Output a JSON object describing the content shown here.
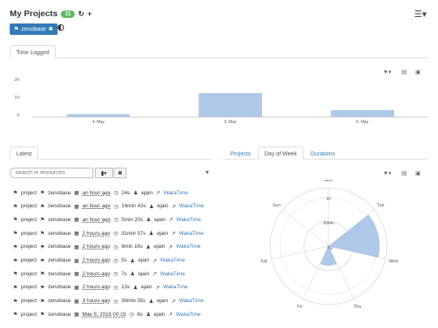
{
  "header": {
    "title": "My Projects",
    "count": "11",
    "refresh_icon": "refresh-icon",
    "add_icon": "plus-icon",
    "menu_icon": "hamburger-menu-icon"
  },
  "filter": {
    "chip_label": "zenobase",
    "chip_color": "#337ab7"
  },
  "time_logged": {
    "tab": "Time Logged",
    "chart_data": {
      "type": "bar",
      "categories": [
        "4. May",
        "5. May",
        "6. May"
      ],
      "values": [
        0.12,
        1.3,
        0.35
      ],
      "yticks": [
        "2h",
        "1h",
        "0"
      ],
      "ylim": [
        0,
        2
      ],
      "color": "#aec8ea"
    }
  },
  "latest": {
    "tab": "Latest",
    "search_placeholder": "search in resources",
    "rows": [
      {
        "tag": "project",
        "project": "zenobase",
        "when": "an hour ago",
        "duration": "24s",
        "user": "ejain",
        "link": "WakaTime"
      },
      {
        "tag": "project",
        "project": "zenobase",
        "when": "an hour ago",
        "duration": "16min 43s",
        "user": "ejain",
        "link": "WakaTime"
      },
      {
        "tag": "project",
        "project": "zenobase",
        "when": "an hour ago",
        "duration": "5min 20s",
        "user": "ejain",
        "link": "WakaTime"
      },
      {
        "tag": "project",
        "project": "zenobase",
        "when": "2 hours ago",
        "duration": "31min 37s",
        "user": "ejain",
        "link": "WakaTime"
      },
      {
        "tag": "project",
        "project": "zenobase",
        "when": "2 hours ago",
        "duration": "9min 19s",
        "user": "ejain",
        "link": "WakaTime"
      },
      {
        "tag": "project",
        "project": "zenobase",
        "when": "2 hours ago",
        "duration": "5s",
        "user": "ejain",
        "link": "WakaTime"
      },
      {
        "tag": "project",
        "project": "zenobase",
        "when": "2 hours ago",
        "duration": "7s",
        "user": "ejain",
        "link": "WakaTime"
      },
      {
        "tag": "project",
        "project": "zenobase",
        "when": "2 hours ago",
        "duration": "13s",
        "user": "ejain",
        "link": "WakaTime"
      },
      {
        "tag": "project",
        "project": "zenobase",
        "when": "3 hours ago",
        "duration": "39min 35s",
        "user": "ejain",
        "link": "WakaTime"
      },
      {
        "tag": "project",
        "project": "zenobase",
        "when": "May 5, 2015 00:15",
        "duration": "6s",
        "user": "ejain",
        "link": "WakaTime"
      }
    ]
  },
  "week": {
    "tabs": [
      "Projects",
      "Day of Week",
      "Durations"
    ],
    "chart_data": {
      "type": "polar",
      "categories": [
        "Mon",
        "Tue",
        "Wed",
        "Thu",
        "Fri",
        "Sat",
        "Sun"
      ],
      "values": [
        0,
        1.05,
        0.1,
        0.4,
        0,
        0,
        0
      ],
      "rings": [
        "1h",
        "30min",
        "0"
      ],
      "color": "#aec8ea"
    }
  }
}
